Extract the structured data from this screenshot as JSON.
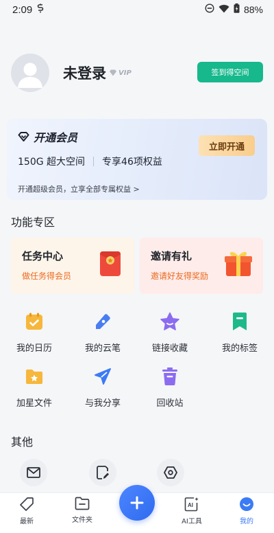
{
  "status": {
    "time": "2:09",
    "battery": "88%"
  },
  "profile": {
    "name": "未登录",
    "vip_badge": "VIP",
    "checkin_label": "签到得空间"
  },
  "vip_card": {
    "title": "开通会员",
    "benefit_space": "150G 超大空间",
    "benefit_rights": "专享46项权益",
    "open_label": "立即开通",
    "subtitle": "开通超级会员，立享全部专属权益 >"
  },
  "features": {
    "section_title": "功能专区",
    "task": {
      "title": "任务中心",
      "subtitle": "做任务得会员"
    },
    "invite": {
      "title": "邀请有礼",
      "subtitle": "邀请好友得奖励"
    }
  },
  "grid": [
    {
      "label": "我的日历",
      "icon": "calendar-icon",
      "color": "#f6b73c"
    },
    {
      "label": "我的云笔",
      "icon": "pen-icon",
      "color": "#4a7df2"
    },
    {
      "label": "链接收藏",
      "icon": "star-icon",
      "color": "#8b6cf0"
    },
    {
      "label": "我的标签",
      "icon": "bookmark-icon",
      "color": "#1fb989"
    },
    {
      "label": "加星文件",
      "icon": "star-folder-icon",
      "color": "#f6b73c"
    },
    {
      "label": "与我分享",
      "icon": "send-icon",
      "color": "#3b7bf5"
    },
    {
      "label": "回收站",
      "icon": "trash-icon",
      "color": "#8b6cf0"
    }
  ],
  "others": {
    "section_title": "其他"
  },
  "nav": {
    "latest": "最新",
    "folder": "文件夹",
    "ai_tools": "AI工具",
    "mine": "我的",
    "active_color": "#3b7bf5"
  }
}
